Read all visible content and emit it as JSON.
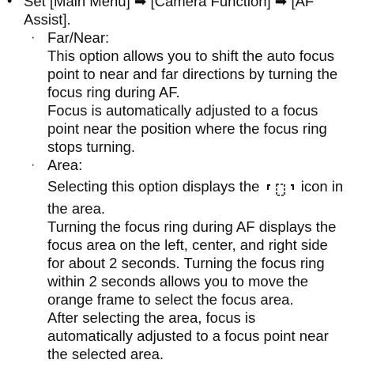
{
  "instruction": {
    "bullet": "•",
    "line1": "Set [Main Menu] ➡ [Camera Function] ➡ [AF",
    "line2": "Assist]."
  },
  "options": [
    {
      "bullet": "·",
      "title": "Far/Near:",
      "lines": [
        "This option allows you to shift the auto focus",
        "point to near and far directions by turning the",
        "focus ring during AF.",
        "Focus is automatically adjusted to a focus",
        "point near the position where the focus ring",
        "stops turning."
      ]
    },
    {
      "bullet": "·",
      "title": "Area:",
      "icon_before": "Selecting this option displays the",
      "icon_name": "focus-area-icon",
      "icon_after": "icon in",
      "lines": [
        "the area.",
        "Turning the focus ring during AF displays the",
        "focus area on the left, center, and right side",
        "for about 2 seconds. Turning the focus ring",
        "within 2 seconds allows you to move the",
        "orange frame to select the focus area.",
        "After selecting the area, focus is",
        "automatically adjusted to a focus point near",
        "the selected area."
      ]
    }
  ]
}
